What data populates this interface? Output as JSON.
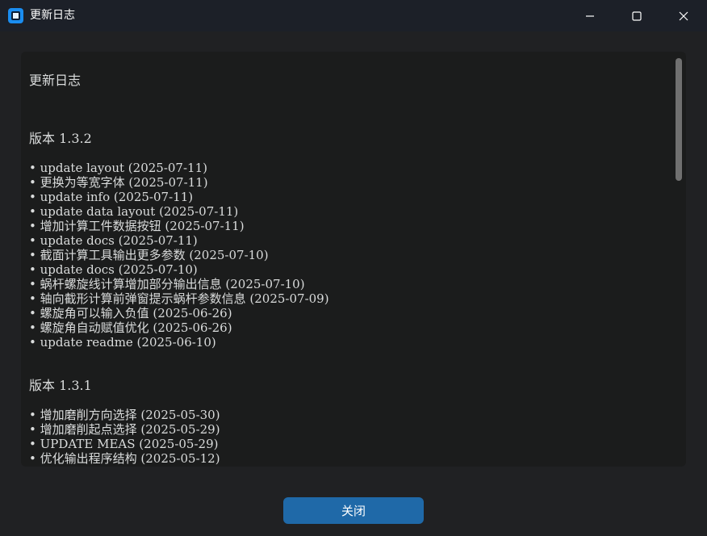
{
  "window": {
    "title": "更新日志",
    "controls": [
      "minimize-icon",
      "maximize-icon",
      "close-icon"
    ]
  },
  "changelog": {
    "title": "更新日志",
    "sections": [
      {
        "heading": "版本 1.3.2",
        "entries": [
          "• update layout (2025-07-11)",
          "• 更换为等宽字体 (2025-07-11)",
          "• update info (2025-07-11)",
          "• update data layout (2025-07-11)",
          "• 增加计算工件数据按钮 (2025-07-11)",
          "• update docs (2025-07-11)",
          "• 截面计算工具输出更多参数 (2025-07-10)",
          "• update docs (2025-07-10)",
          "• 蜗杆螺旋线计算增加部分输出信息 (2025-07-10)",
          "• 轴向截形计算前弹窗提示蜗杆参数信息 (2025-07-09)",
          "• 螺旋角可以输入负值 (2025-06-26)",
          "• 螺旋角自动赋值优化 (2025-06-26)",
          "• update readme (2025-06-10)"
        ]
      },
      {
        "heading": "版本 1.3.1",
        "entries": [
          "• 增加磨削方向选择 (2025-05-30)",
          "• 增加磨削起点选择 (2025-05-29)",
          "• UPDATE MEAS (2025-05-29)",
          "• 优化输出程序结构 (2025-05-12)"
        ]
      }
    ]
  },
  "footer": {
    "close_label": "关闭"
  },
  "colors": {
    "accent": "#1f69a8",
    "titlebar": "#1c2028",
    "panel": "#1b1c1c"
  }
}
